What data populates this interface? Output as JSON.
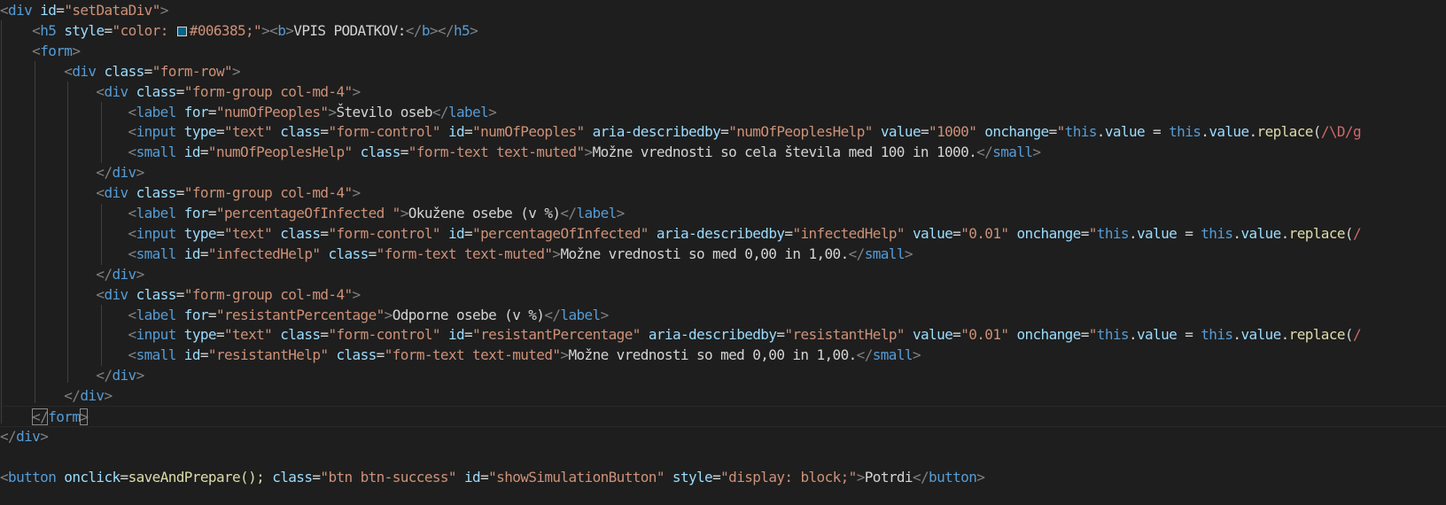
{
  "colors": {
    "background": "#1e1e1e",
    "tag": "#569cd6",
    "attribute": "#9cdcfe",
    "string": "#ce9178",
    "punctuation": "#808080",
    "text": "#d4d4d4",
    "function": "#dcdcaa",
    "regex": "#d16969",
    "swatch": "#006385"
  },
  "code": {
    "l1": {
      "o": "<",
      "tag": "div",
      "a1": "id",
      "eq": "=",
      "v1": "\"setDataDiv\"",
      "c": ">"
    },
    "l2": {
      "o": "<",
      "tag": "h5",
      "a1": "style",
      "eq": "=",
      "v1a": "\"color: ",
      "v1b": "#006385;\"",
      "c1": ">",
      "o2": "<",
      "btag": "b",
      "c2": ">",
      "text": "VPIS PODATKOV:",
      "e1": "</",
      "btag2": "b",
      "e1c": ">",
      "e2": "</",
      "tag2": "h5",
      "e2c": ">"
    },
    "l3": {
      "o": "<",
      "tag": "form",
      "c": ">"
    },
    "l4": {
      "o": "<",
      "tag": "div",
      "a1": "class",
      "eq": "=",
      "v1": "\"form-row\"",
      "c": ">"
    },
    "l5": {
      "o": "<",
      "tag": "div",
      "a1": "class",
      "eq": "=",
      "v1": "\"form-group col-md-4\"",
      "c": ">"
    },
    "l6": {
      "o": "<",
      "tag": "label",
      "a1": "for",
      "eq": "=",
      "v1": "\"numOfPeoples\"",
      "c": ">",
      "text": "Število oseb",
      "e": "</",
      "tag2": "label",
      "ec": ">"
    },
    "l7": {
      "o": "<",
      "tag": "input",
      "a1": "type",
      "eq1": "=",
      "v1": "\"text\"",
      "a2": "class",
      "eq2": "=",
      "v2": "\"form-control\"",
      "a3": "id",
      "eq3": "=",
      "v3": "\"numOfPeoples\"",
      "a4": "aria-describedby",
      "eq4": "=",
      "v4": "\"numOfPeoplesHelp\"",
      "a5": "value",
      "eq5": "=",
      "v5": "\"1000\"",
      "a6": "onchange",
      "eq6": "=",
      "q": "\"",
      "this1": "this",
      "dot1": ".",
      "prop1": "value",
      "mid": " = ",
      "this2": "this",
      "dot2": ".",
      "prop2": "value",
      "dot3": ".",
      "fn": "replace",
      "paren": "(",
      "rx": "/\\D/g"
    },
    "l8": {
      "o": "<",
      "tag": "small",
      "a1": "id",
      "eq1": "=",
      "v1": "\"numOfPeoplesHelp\"",
      "a2": "class",
      "eq2": "=",
      "v2": "\"form-text text-muted\"",
      "c": ">",
      "text": "Možne vrednosti so cela števila med 100 in 1000.",
      "e": "</",
      "tag2": "small",
      "ec": ">"
    },
    "l9": {
      "o": "</",
      "tag": "div",
      "c": ">"
    },
    "l10": {
      "o": "<",
      "tag": "div",
      "a1": "class",
      "eq": "=",
      "v1": "\"form-group col-md-4\"",
      "c": ">"
    },
    "l11": {
      "o": "<",
      "tag": "label",
      "a1": "for",
      "eq": "=",
      "v1": "\"percentageOfInfected \"",
      "c": ">",
      "text": "Okužene osebe (v %)",
      "e": "</",
      "tag2": "label",
      "ec": ">"
    },
    "l12": {
      "o": "<",
      "tag": "input",
      "a1": "type",
      "eq1": "=",
      "v1": "\"text\"",
      "a2": "class",
      "eq2": "=",
      "v2": "\"form-control\"",
      "a3": "id",
      "eq3": "=",
      "v3": "\"percentageOfInfected\"",
      "a4": "aria-describedby",
      "eq4": "=",
      "v4": "\"infectedHelp\"",
      "a5": "value",
      "eq5": "=",
      "v5": "\"0.01\"",
      "a6": "onchange",
      "eq6": "=",
      "q": "\"",
      "this1": "this",
      "dot1": ".",
      "prop1": "value",
      "mid": " = ",
      "this2": "this",
      "dot2": ".",
      "prop2": "value",
      "dot3": ".",
      "fn": "replace",
      "paren": "(",
      "rx": "/"
    },
    "l13": {
      "o": "<",
      "tag": "small",
      "a1": "id",
      "eq1": "=",
      "v1": "\"infectedHelp\"",
      "a2": "class",
      "eq2": "=",
      "v2": "\"form-text text-muted\"",
      "c": ">",
      "text": "Možne vrednosti so med 0,00 in 1,00.",
      "e": "</",
      "tag2": "small",
      "ec": ">"
    },
    "l14": {
      "o": "</",
      "tag": "div",
      "c": ">"
    },
    "l15": {
      "o": "<",
      "tag": "div",
      "a1": "class",
      "eq": "=",
      "v1": "\"form-group col-md-4\"",
      "c": ">"
    },
    "l16": {
      "o": "<",
      "tag": "label",
      "a1": "for",
      "eq": "=",
      "v1": "\"resistantPercentage\"",
      "c": ">",
      "text": "Odporne osebe (v %)",
      "e": "</",
      "tag2": "label",
      "ec": ">"
    },
    "l17": {
      "o": "<",
      "tag": "input",
      "a1": "type",
      "eq1": "=",
      "v1": "\"text\"",
      "a2": "class",
      "eq2": "=",
      "v2": "\"form-control\"",
      "a3": "id",
      "eq3": "=",
      "v3": "\"resistantPercentage\"",
      "a4": "aria-describedby",
      "eq4": "=",
      "v4": "\"resistantHelp\"",
      "a5": "value",
      "eq5": "=",
      "v5": "\"0.01\"",
      "a6": "onchange",
      "eq6": "=",
      "q": "\"",
      "this1": "this",
      "dot1": ".",
      "prop1": "value",
      "mid": " = ",
      "this2": "this",
      "dot2": ".",
      "prop2": "value",
      "dot3": ".",
      "fn": "replace",
      "paren": "(",
      "rx": "/"
    },
    "l18": {
      "o": "<",
      "tag": "small",
      "a1": "id",
      "eq1": "=",
      "v1": "\"resistantHelp\"",
      "a2": "class",
      "eq2": "=",
      "v2": "\"form-text text-muted\"",
      "c": ">",
      "text": "Možne vrednosti so med 0,00 in 1,00.",
      "e": "</",
      "tag2": "small",
      "ec": ">"
    },
    "l19": {
      "o": "</",
      "tag": "div",
      "c": ">"
    },
    "l20": {
      "o": "</",
      "tag": "div",
      "c": ">"
    },
    "l21": {
      "o": "</",
      "tag": "form",
      "c": ">"
    },
    "l22": {
      "o": "</",
      "tag": "div",
      "c": ">"
    },
    "l24": {
      "o": "<",
      "tag": "button",
      "a1": "onclick",
      "eq1": "=",
      "v1": "saveAndPrepare();",
      "a2": "class",
      "eq2": "=",
      "v2": "\"btn btn-success\"",
      "a3": "id",
      "eq3": "=",
      "v3": "\"showSimulationButton\"",
      "a4": "style",
      "eq4": "=",
      "v4": "\"display: block;\"",
      "c": ">",
      "text": "Potrdi",
      "e": "</",
      "tag2": "button",
      "ec": ">"
    }
  }
}
